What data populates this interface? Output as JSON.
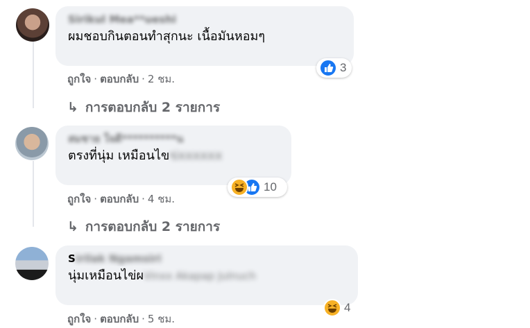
{
  "comments": [
    {
      "name": "Sirikul Mea**ueshi",
      "text": "ผมชอบกินตอนทำสุกนะ เนื้อมันหอมๆ",
      "text_hidden": "",
      "reaction_count": "3",
      "reactions": [
        "like-icon"
      ],
      "actions": {
        "like": "ถูกใจ",
        "reply": "ตอบกลับ",
        "time": "2 ชม."
      },
      "replies": "การตอบกลับ 2 รายการ"
    },
    {
      "name": "สมชาย ใจดี**********น",
      "text": "ตรงที่นุ่ม เหมือนไข",
      "text_hidden": "ข่xxxxxx",
      "reaction_count": "10",
      "reactions": [
        "haha-icon",
        "like-icon"
      ],
      "actions": {
        "like": "ถูกใจ",
        "reply": "ตอบกลับ",
        "time": "4 ชม."
      },
      "replies": "การตอบกลับ 2 รายการ"
    },
    {
      "name": "S",
      "name_hidden": "irilak Ngamsiri",
      "text": "นุ่มเหมือนไข่ผ",
      "text_hidden": "Vinxx Akapap Julnuch",
      "reaction_count": "4",
      "reactions": [
        "haha-icon"
      ],
      "actions": {
        "like": "ถูกใจ",
        "reply": "ตอบกลับ",
        "time": "5 ชม."
      }
    }
  ],
  "separator": "·",
  "reply_arrow": "↳",
  "colors": {
    "bubble": "#f0f2f5",
    "meta": "#65676b",
    "like": "#1877f2",
    "haha": "#f7b125"
  }
}
